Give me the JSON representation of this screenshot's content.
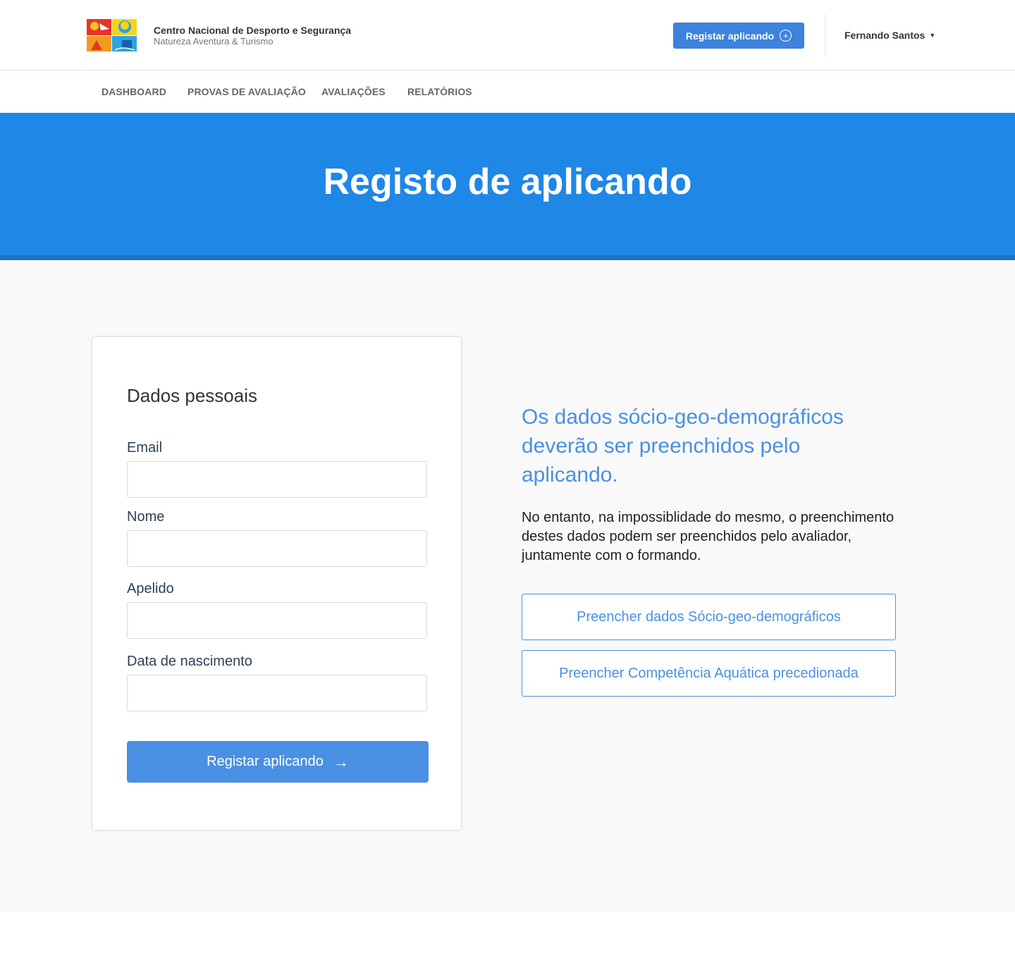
{
  "header": {
    "org_name": "Centro Nacional de Desporto e Segurança",
    "org_subtitle": "Natureza Aventura & Turismo",
    "register_button": "Registar aplicando",
    "user_name": "Fernando Santos"
  },
  "nav": {
    "items": [
      {
        "label": "DASHBOARD"
      },
      {
        "label": "PROVAS DE AVALIAÇÃO"
      },
      {
        "label": "AVALIAÇÕES"
      },
      {
        "label": "RELATÓRIOS"
      }
    ]
  },
  "hero": {
    "title": "Registo de aplicando"
  },
  "form": {
    "title": "Dados pessoais",
    "fields": [
      {
        "label": "Email",
        "value": ""
      },
      {
        "label": "Nome",
        "value": ""
      },
      {
        "label": "Apelido",
        "value": ""
      },
      {
        "label": "Data de nascimento",
        "value": ""
      }
    ],
    "submit_label": "Registar aplicando"
  },
  "info": {
    "heading": "Os dados sócio-geo-demográficos deverão ser preenchidos pelo aplicando.",
    "body": "No entanto, na impossiblidade do mesmo, o preenchimento destes dados podem ser preenchidos pelo avaliador, juntamente com o formando.",
    "button_socio": "Preencher dados Sócio-geo-demográficos",
    "button_aquatica": "Preencher Competência Aquática precedionada"
  },
  "colors": {
    "primary": "#4a90e2",
    "hero": "#1f87e5",
    "hero_bar": "#1872cc"
  },
  "icons": [
    "logo",
    "plus-circle-icon",
    "chevron-down-icon",
    "arrow-right-icon"
  ]
}
